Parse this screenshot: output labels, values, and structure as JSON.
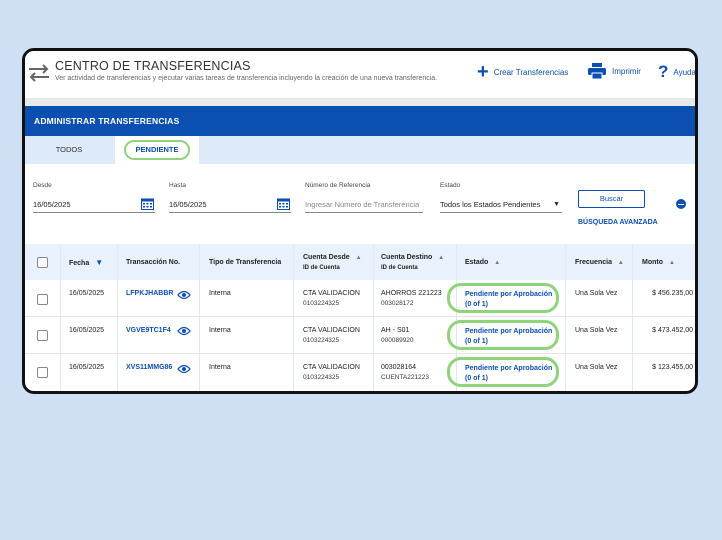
{
  "header": {
    "title": "CENTRO DE TRANSFERENCIAS",
    "subtitle": "Ver actividad de transferencias y ejecutar varias tareas de transferencia incluyendo la creación de una nueva transferencia.",
    "actions": {
      "new_transfer": "Crear Transferencias",
      "print": "Imprimir",
      "help": "Ayuda"
    }
  },
  "section_title": "ADMINISTRAR TRANSFERENCIAS",
  "tabs": [
    {
      "label": "TODOS"
    },
    {
      "label": "PENDIENTE",
      "active": true
    }
  ],
  "filters": {
    "desde_label": "Desde",
    "desde_value": "16/05/2025",
    "hasta_label": "Hasta",
    "hasta_value": "16/05/2025",
    "referencia_label": "Número de Referencia",
    "referencia_placeholder": "Ingresar Número de Transferencia",
    "estado_label": "Estado",
    "estado_value": "Todos los Estados Pendientes",
    "search_button": "Buscar",
    "advanced_link": "BÚSQUEDA AVANZADA"
  },
  "table": {
    "columns": {
      "fecha": "Fecha",
      "transaccion": "Transacción No.",
      "tipo": "Tipo de Transferencia",
      "cuenta_desde": "Cuenta Desde",
      "cuenta_desde_sub": "ID de Cuenta",
      "cuenta_destino": "Cuenta Destino",
      "cuenta_destino_sub": "ID de Cuenta",
      "estado": "Estado",
      "frecuencia": "Frecuencia",
      "monto": "Monto"
    },
    "rows": [
      {
        "fecha": "16/05/2025",
        "transaccion": "LFPKJHABBR",
        "tipo": "Interna",
        "desde_name": "CTA VALIDACION",
        "desde_id": "0103224325",
        "destino_name": "AHORROS 221223",
        "destino_id": "003028172",
        "estado_line1": "Pendiente por Aprobación",
        "estado_line2": "(0 of 1)",
        "frecuencia": "Una Sola Vez",
        "monto": "$ 456.235,00"
      },
      {
        "fecha": "16/05/2025",
        "transaccion": "VGVE9TC1F4",
        "tipo": "Interna",
        "desde_name": "CTA VALIDACION",
        "desde_id": "0103224325",
        "destino_name": "AH - S01",
        "destino_id": "000089920",
        "estado_line1": "Pendiente por Aprobación",
        "estado_line2": "(0 of 1)",
        "frecuencia": "Una Sola Vez",
        "monto": "$ 473.452,00"
      },
      {
        "fecha": "16/05/2025",
        "transaccion": "XVS11MMG86",
        "tipo": "Interna",
        "desde_name": "CTA VALIDACION",
        "desde_id": "0103224325",
        "destino_name": "003028164",
        "destino_id": "CUENTA221223",
        "estado_line1": "Pendiente por Aprobación",
        "estado_line2": "(0 of 1)",
        "frecuencia": "Una Sola Vez",
        "monto": "$ 123.455,00"
      }
    ]
  },
  "colors": {
    "brand_blue": "#0b4fb0",
    "highlight_green": "#8fd47a",
    "tab_bg": "#ddeafa",
    "background": "#cfe0f5"
  },
  "icons": [
    "transfer-arrows-icon",
    "plus-icon",
    "printer-icon",
    "help-icon",
    "calendar-icon",
    "chevron-down-icon",
    "collapse-icon",
    "eye-icon",
    "sort-arrow-icon"
  ]
}
